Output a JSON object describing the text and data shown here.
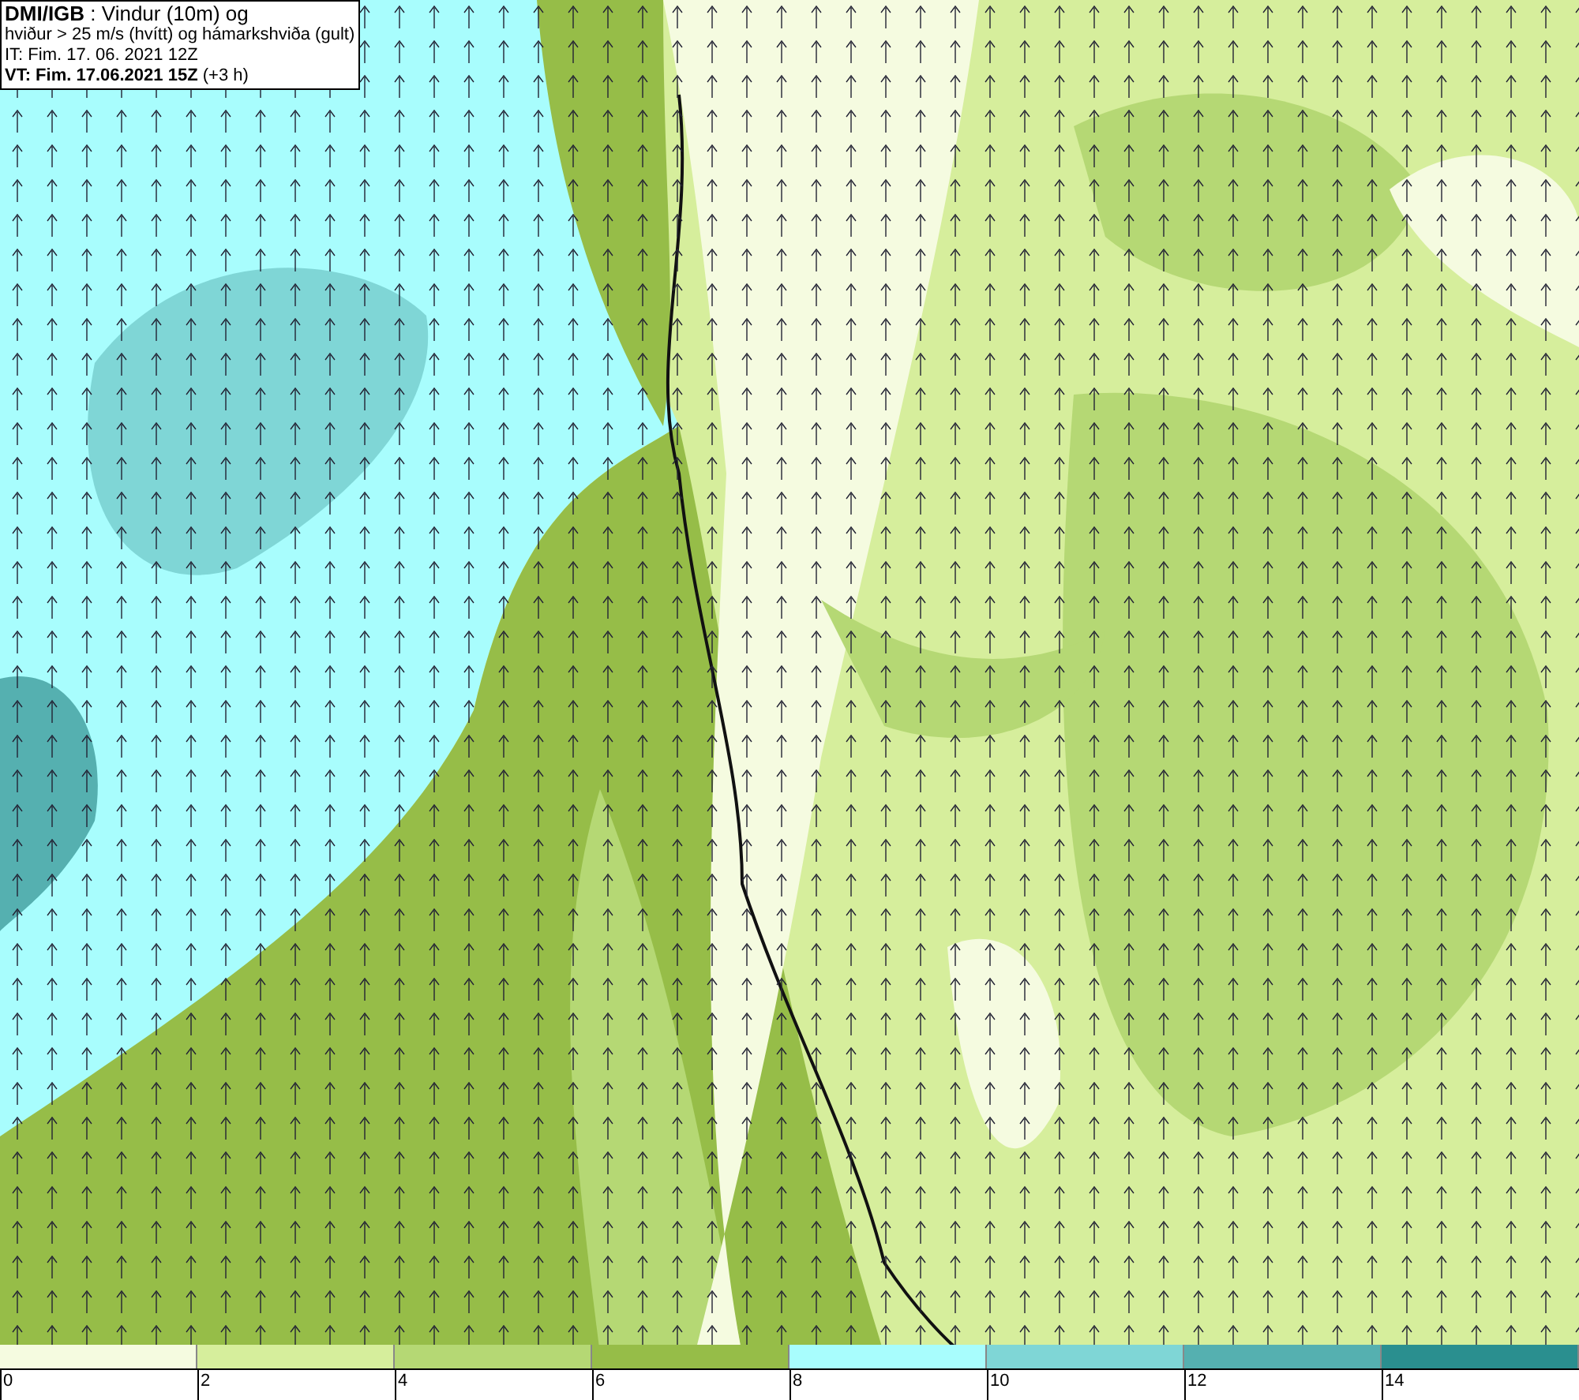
{
  "title_box": {
    "lines": [
      "**DMI/IGB** : Vindur (10m) og",
      "hviður > 25 m/s (hvítt) og hámarkshviða (gult)",
      "IT: Fim. 17. 06. 2021 12Z",
      "**VT: Fim. 17.06.2021 15Z** (+3 h)"
    ]
  },
  "legend": {
    "bins": [
      {
        "label": "0",
        "color": "#f5fbe0"
      },
      {
        "label": "2",
        "color": "#d6ee9c"
      },
      {
        "label": "4",
        "color": "#b5d874"
      },
      {
        "label": "6",
        "color": "#96bd48"
      },
      {
        "label": "8",
        "color": "#a8fdfd"
      },
      {
        "label": "10",
        "color": "#7fd6d6"
      },
      {
        "label": "12",
        "color": "#55b0b0"
      },
      {
        "label": "14",
        "color": "#2a8f8f"
      }
    ]
  }
}
